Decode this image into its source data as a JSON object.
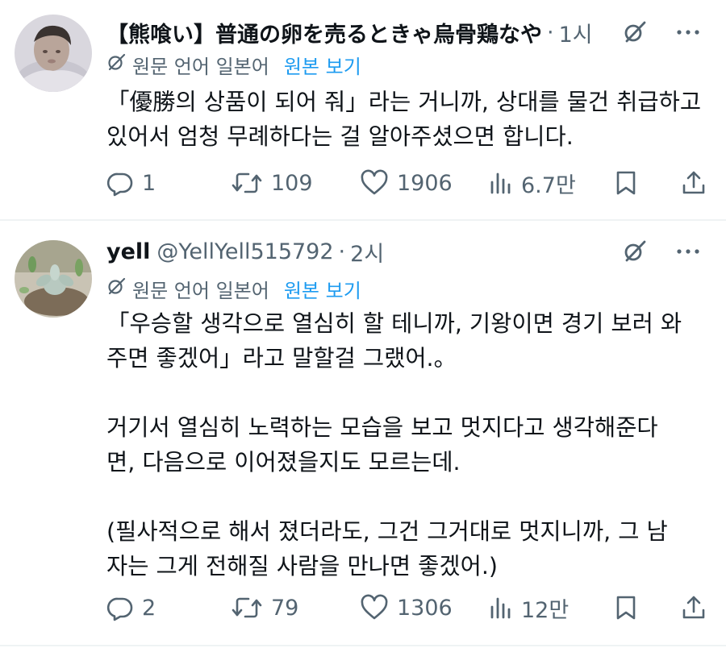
{
  "tweets": [
    {
      "name": "【熊喰い】普通の卵を売るときゃ烏骨鶏なや",
      "handle": "",
      "separator": "·",
      "time": "1시",
      "translate_note": "원문 언어 일본어",
      "view_original": "원본 보기",
      "body_lines": [
        "「優勝의 상품이 되어 줘」라는 거니까, 상대를 물건 취급하고",
        "있어서 엄청 무례하다는 걸 알아주셨으면 합니다."
      ],
      "actions": {
        "replies": "1",
        "reposts": "109",
        "likes": "1906",
        "views": "6.7만"
      },
      "avatar_icon": "baby-photo-avatar"
    },
    {
      "name": "yell",
      "handle": "@YellYell515792",
      "separator": "·",
      "time": "2시",
      "translate_note": "원문 언어 일본어",
      "view_original": "원본 보기",
      "body_lines": [
        "「우승할 생각으로 열심히 할 테니까, 기왕이면 경기 보러 와",
        "주면 좋겠어」라고 말할걸 그랬어.。",
        "",
        "거기서 열심히 노력하는 모습을 보고 멋지다고 생각해준다",
        "면, 다음으로 이어졌을지도 모르는데.",
        "",
        "(필사적으로 해서 졌더라도, 그건 그거대로 멋지니까, 그 남",
        "자는 그게 전해질 사람을 만나면 좋겠어.)"
      ],
      "actions": {
        "replies": "2",
        "reposts": "79",
        "likes": "1306",
        "views": "12만"
      },
      "avatar_icon": "succulent-plant-avatar"
    }
  ],
  "colors": {
    "text": "#0f1419",
    "secondary": "#536471",
    "link": "#1d9bf0",
    "divider": "#eff3f4"
  },
  "icons": [
    "grok-icon",
    "more-icon",
    "translate-icon",
    "reply-icon",
    "repost-icon",
    "like-icon",
    "views-icon",
    "bookmark-icon",
    "share-icon"
  ]
}
